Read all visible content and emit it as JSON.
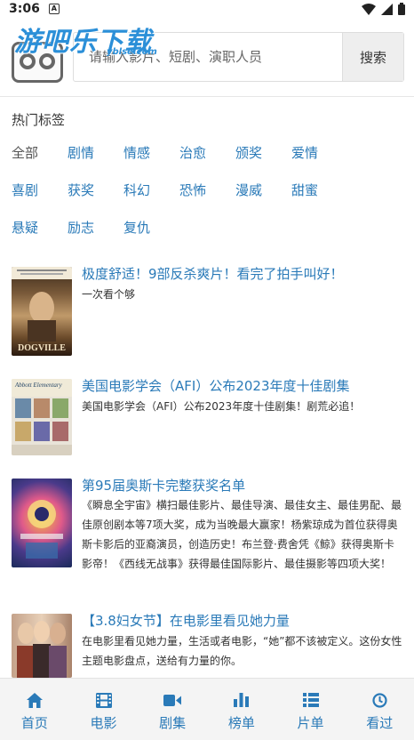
{
  "status_bar": {
    "time": "3:06",
    "notification_letter": "A"
  },
  "header": {
    "watermark": "游吧乐下载",
    "watermark_sub": "yblse.com",
    "search": {
      "placeholder": "请输入影片、短剧、演职人员",
      "value": "",
      "button_label": "搜索"
    }
  },
  "tags": {
    "title": "热门标签",
    "items": [
      "全部",
      "剧情",
      "情感",
      "治愈",
      "颁奖",
      "爱情",
      "喜剧",
      "获奖",
      "科幻",
      "恐怖",
      "漫威",
      "甜蜜",
      "悬疑",
      "励志",
      "复仇"
    ],
    "active_index": 0
  },
  "articles": [
    {
      "title": "极度舒适！9部反杀爽片！看完了拍手叫好！",
      "desc": "一次看个够",
      "thumb_text": "DOGVILLE"
    },
    {
      "title": "美国电影学会（AFI）公布2023年度十佳剧集",
      "desc": "美国电影学会（AFI）公布2023年度十佳剧集！剧荒必追！",
      "thumb_text": "Abbott Elementary"
    },
    {
      "title": "第95届奥斯卡完整获奖名单",
      "desc": "《瞬息全宇宙》横扫最佳影片、最佳导演、最佳女主、最佳男配、最佳原创剧本等7项大奖，成为当晚最大赢家！杨紫琼成为首位获得奥斯卡影后的亚裔演员，创造历史！布兰登·费舍凭《鲸》获得奥斯卡影帝！《西线无战事》获得最佳国际影片、最佳摄影等四项大奖！",
      "thumb_text": ""
    },
    {
      "title": "【3.8妇女节】在电影里看见她力量",
      "desc": "在电影里看见她力量，生活或者电影，“她”都不该被定义。这份女性主题电影盘点，送给有力量的你。",
      "thumb_text": ""
    }
  ],
  "bottom_nav": [
    {
      "label": "首页",
      "icon": "home-icon"
    },
    {
      "label": "电影",
      "icon": "film-icon"
    },
    {
      "label": "剧集",
      "icon": "video-camera-icon"
    },
    {
      "label": "榜单",
      "icon": "bar-chart-icon"
    },
    {
      "label": "片单",
      "icon": "list-icon"
    },
    {
      "label": "看过",
      "icon": "clock-icon"
    }
  ],
  "colors": {
    "accent": "#2a7ab8",
    "watermark": "#2b8fd8",
    "nav_bg": "#f4f4f4"
  }
}
